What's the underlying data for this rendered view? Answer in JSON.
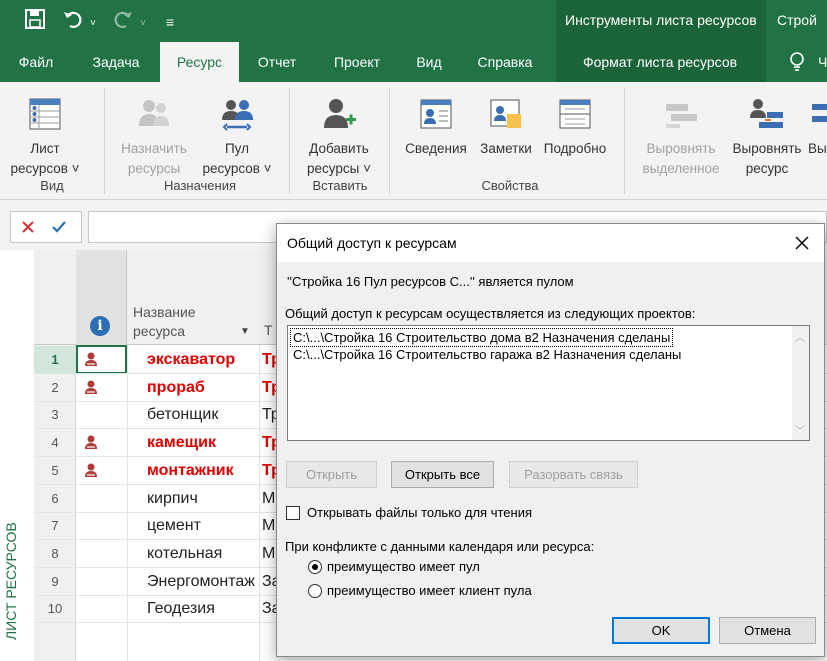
{
  "titlebar": {
    "context_title": "Инструменты листа ресурсов",
    "context_title2": "Строй"
  },
  "tabs": [
    {
      "label": "Файл"
    },
    {
      "label": "Задача"
    },
    {
      "label": "Ресурс"
    },
    {
      "label": "Отчет"
    },
    {
      "label": "Проект"
    },
    {
      "label": "Вид"
    },
    {
      "label": "Справка"
    },
    {
      "label": "Формат листа ресурсов"
    }
  ],
  "ribbon": {
    "buttons": [
      {
        "line1": "Лист",
        "line2": "ресурсов ˅",
        "icon": "resource-sheet-icon"
      },
      {
        "line1": "Назначить",
        "line2": "ресурсы",
        "icon": "assign-resources-icon"
      },
      {
        "line1": "Пул",
        "line2": "ресурсов ˅",
        "icon": "resource-pool-icon"
      },
      {
        "line1": "Добавить",
        "line2": "ресурсы ˅",
        "icon": "add-resources-icon"
      },
      {
        "line1": "Сведения",
        "line2": "",
        "icon": "information-icon"
      },
      {
        "line1": "Заметки",
        "line2": "",
        "icon": "notes-icon"
      },
      {
        "line1": "Подробно",
        "line2": "",
        "icon": "details-icon"
      },
      {
        "line1": "Выровнять",
        "line2": "выделенное",
        "icon": "level-selection-icon"
      },
      {
        "line1": "Выровнять",
        "line2": "ресурс",
        "icon": "level-resource-icon"
      },
      {
        "line1": "Вы",
        "line2": "",
        "icon": "level-all-icon"
      }
    ],
    "groups": [
      "Вид",
      "Назначения",
      "Вставить",
      "Свойства"
    ]
  },
  "sheet": {
    "side_label": "ЛИСТ РЕСУРСОВ",
    "header_name": "Название ресурса",
    "header_name_line1": "Название",
    "header_name_line2": "ресурса",
    "header_type": "Т",
    "rows": [
      {
        "num": "1",
        "name": "экскаватор",
        "type": "Тр",
        "red": true,
        "pool": true
      },
      {
        "num": "2",
        "name": "прораб",
        "type": "Тр",
        "red": true,
        "pool": true
      },
      {
        "num": "3",
        "name": "бетонщик",
        "type": "Тр",
        "red": false,
        "pool": false
      },
      {
        "num": "4",
        "name": "камещик",
        "type": "Тр",
        "red": true,
        "pool": true
      },
      {
        "num": "5",
        "name": "монтажник",
        "type": "Тр",
        "red": true,
        "pool": true
      },
      {
        "num": "6",
        "name": "кирпич",
        "type": "М",
        "red": false,
        "pool": false
      },
      {
        "num": "7",
        "name": "цемент",
        "type": "М",
        "red": false,
        "pool": false
      },
      {
        "num": "8",
        "name": "котельная",
        "type": "М",
        "red": false,
        "pool": false
      },
      {
        "num": "9",
        "name": "Энергомонтаж",
        "type": "За",
        "red": false,
        "pool": false
      },
      {
        "num": "10",
        "name": "Геодезия",
        "type": "За",
        "red": false,
        "pool": false
      }
    ]
  },
  "dialog": {
    "title": "Общий доступ к ресурсам",
    "pool_line": "''Стройка 16 Пул ресурсов С...'' является пулом",
    "shared_label": "Общий доступ к ресурсам осуществляется из следующих проектов:",
    "projects": [
      "C:\\...\\Стройка 16 Строительство дома в2 Назначения сделаны",
      "C:\\...\\Стройка 16 Строительство гаража в2 Назначения сделаны"
    ],
    "btn_open": "Открыть",
    "btn_open_all": "Открыть все",
    "btn_unlink": "Разорвать связь",
    "readonly_label": "Открывать файлы только для чтения",
    "conflict_label": "При конфликте с данными календаря или ресурса:",
    "radio_pool": "преимущество имеет пул",
    "radio_client": "преимущество имеет клиент пула",
    "btn_ok": "OK",
    "btn_cancel": "Отмена"
  }
}
